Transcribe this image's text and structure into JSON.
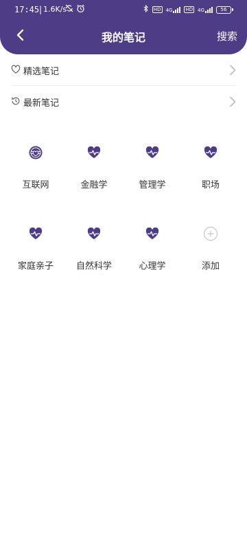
{
  "status_bar": {
    "time": "17:45",
    "speed": "1.6K/s",
    "signal_1": "4G",
    "signal_2": "4G",
    "hd_1": "HD",
    "hd_2": "HD",
    "battery": "56"
  },
  "header": {
    "title": "我的笔记",
    "search_label": "搜索"
  },
  "menu": [
    {
      "label": "精选笔记",
      "icon": "heart-outline-icon"
    },
    {
      "label": "最新笔记",
      "icon": "clock-history-icon"
    }
  ],
  "categories": [
    {
      "label": "互联网",
      "icon": "globe-heart-icon"
    },
    {
      "label": "金融学",
      "icon": "heart-pulse-icon"
    },
    {
      "label": "管理学",
      "icon": "heart-pulse-icon"
    },
    {
      "label": "职场",
      "icon": "heart-pulse-icon"
    },
    {
      "label": "家庭亲子",
      "icon": "heart-pulse-icon"
    },
    {
      "label": "自然科学",
      "icon": "heart-pulse-icon"
    },
    {
      "label": "心理学",
      "icon": "heart-pulse-icon"
    },
    {
      "label": "添加",
      "icon": "plus-circle-icon"
    }
  ],
  "colors": {
    "primary": "#4e3c86",
    "icon_gray": "#c8c8c8",
    "text": "#333333"
  }
}
